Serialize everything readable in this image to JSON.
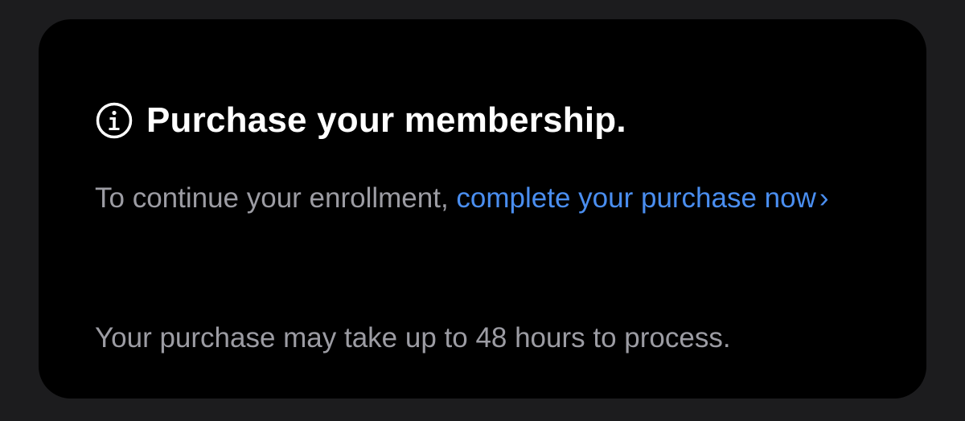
{
  "card": {
    "title": "Purchase your membership.",
    "icon": "info-circle-icon",
    "lead_text": "To continue your enrollment, ",
    "link_text": "complete your purchase now",
    "link_chevron": "›",
    "note": "Your purchase may take up to 48 hours to process."
  },
  "colors": {
    "background": "#1c1c1e",
    "card": "#000000",
    "title": "#ffffff",
    "body_text": "#9c9ca3",
    "link": "#4a8ef0"
  }
}
